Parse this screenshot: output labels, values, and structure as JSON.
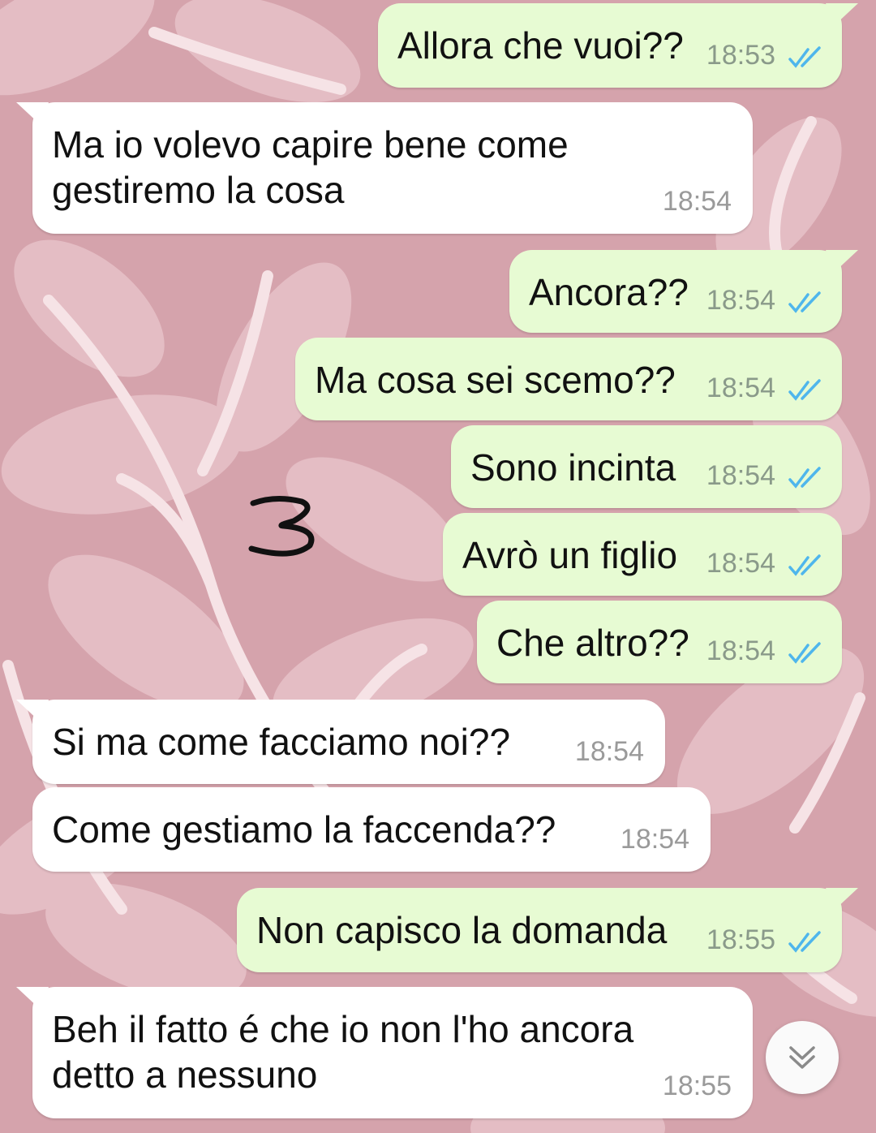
{
  "messages": [
    {
      "direction": "outgoing",
      "text": "Allora che vuoi??",
      "time": "18:53",
      "status": "read"
    },
    {
      "direction": "incoming",
      "text": "Ma io volevo capire bene come gestiremo la cosa",
      "text_line1": "Ma io volevo capire bene come",
      "text_line2": "gestiremo la cosa",
      "time": "18:54"
    },
    {
      "direction": "outgoing",
      "text": "Ancora??",
      "time": "18:54",
      "status": "read"
    },
    {
      "direction": "outgoing",
      "text": "Ma cosa sei scemo??",
      "time": "18:54",
      "status": "read"
    },
    {
      "direction": "outgoing",
      "text": "Sono incinta",
      "time": "18:54",
      "status": "read"
    },
    {
      "direction": "outgoing",
      "text": "Avrò un figlio",
      "time": "18:54",
      "status": "read"
    },
    {
      "direction": "outgoing",
      "text": "Che altro??",
      "time": "18:54",
      "status": "read"
    },
    {
      "direction": "incoming",
      "text": "Si ma come facciamo noi??",
      "time": "18:54"
    },
    {
      "direction": "incoming",
      "text": "Come gestiamo la faccenda??",
      "time": "18:54"
    },
    {
      "direction": "outgoing",
      "text": "Non capisco la domanda",
      "time": "18:55",
      "status": "read"
    },
    {
      "direction": "incoming",
      "text": "Beh il fatto é che io non l'ho ancora detto a nessuno",
      "text_line1": "Beh il fatto é che io non l'ho ancora",
      "text_line2": "detto a nessuno",
      "time": "18:55"
    }
  ],
  "annotation": {
    "text": "3"
  },
  "scroll_button": {
    "icon": "double-chevron-down-icon"
  },
  "colors": {
    "wallpaper": "#d5a3ac",
    "wallpaper_leaves": "#e8c4ca",
    "outgoing_bubble": "#e7fbd3",
    "incoming_bubble": "#ffffff",
    "read_ticks": "#4fb6ec"
  }
}
